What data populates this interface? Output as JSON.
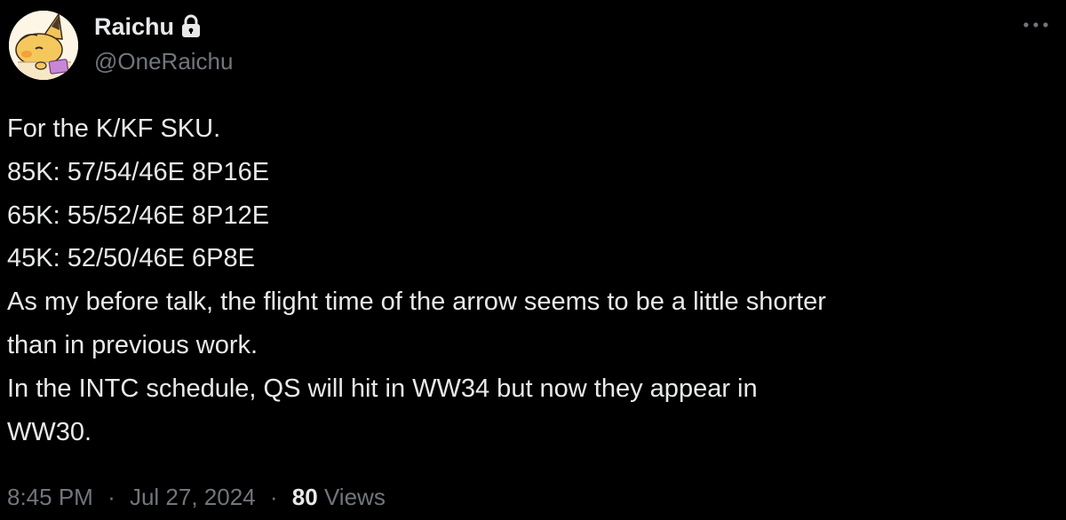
{
  "post": {
    "author": {
      "display_name": "Raichu",
      "handle": "@OneRaichu",
      "protected_icon": "lock-icon",
      "avatar": "raichu-avatar"
    },
    "more_icon": "more-horizontal-icon",
    "lines": [
      "For the K/KF SKU.",
      "85K: 57/54/46E 8P16E",
      "65K: 55/52/46E 8P12E",
      "45K: 52/50/46E 6P8E",
      "As my before talk, the flight time of the arrow seems to be a little shorter",
      "than in previous work.",
      "In the INTC schedule, QS will hit in WW34 but now they appear in",
      "WW30."
    ],
    "footer": {
      "time": "8:45 PM",
      "separator": "·",
      "date": "Jul 27, 2024",
      "views_count": "80",
      "views_label": "Views"
    }
  },
  "colors": {
    "background": "#000000",
    "primary_text": "#e7e9ea",
    "secondary_text": "#71767b"
  }
}
